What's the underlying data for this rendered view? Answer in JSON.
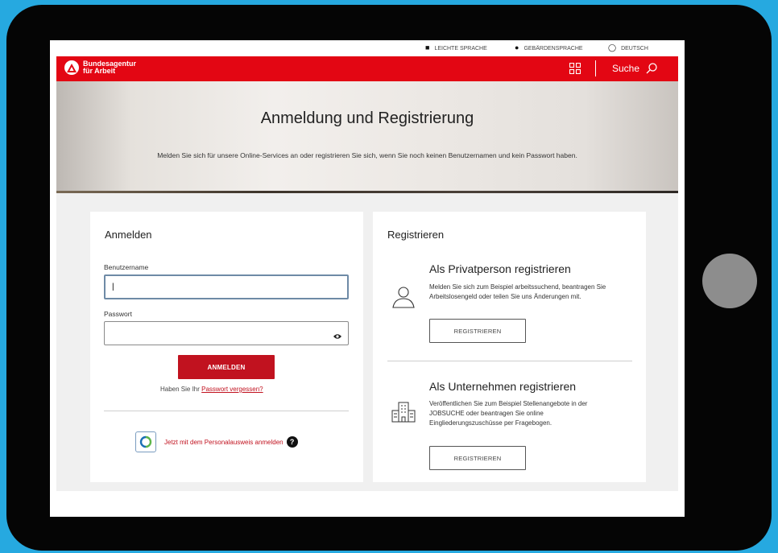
{
  "topbar": {
    "links": [
      {
        "icon": "phone-icon",
        "label": "LEICHTE SPRACHE"
      },
      {
        "icon": "location-icon",
        "label": "GEBÄRDENSPRACHE"
      },
      {
        "icon": "globe-icon",
        "label": "DEUTSCH"
      }
    ]
  },
  "header": {
    "logo_line1": "Bundesagentur",
    "logo_line2": "für Arbeit",
    "search_label": "Suche"
  },
  "hero": {
    "title": "Anmeldung und Registrierung",
    "subtitle": "Melden Sie sich für unsere Online-Services an oder registrieren Sie sich, wenn Sie noch keinen Benutzernamen und kein Passwort haben."
  },
  "login": {
    "title": "Anmelden",
    "username_label": "Benutzername",
    "username_value": "|",
    "password_label": "Passwort",
    "password_value": "",
    "submit_label": "ANMELDEN",
    "forgot_prefix": "Haben Sie Ihr ",
    "forgot_link": "Passwort vergessen?",
    "eid_link": "Jetzt mit dem Personalausweis anmelden",
    "help_glyph": "?"
  },
  "register": {
    "title": "Registrieren",
    "private": {
      "title": "Als Privatperson registrieren",
      "desc": "Melden Sie sich zum Beispiel arbeitssuchend, beantragen Sie Arbeitslosengeld oder teilen Sie uns Änderungen mit.",
      "button": "REGISTRIEREN"
    },
    "company": {
      "title": "Als Unternehmen registrieren",
      "desc": "Veröffentlichen Sie zum Beispiel Stellenangebote in der JOBSUCHE oder beantragen Sie online Eingliederungszuschüsse per Fragebogen.",
      "button": "REGISTRIEREN"
    }
  },
  "colors": {
    "brand_red": "#e30613",
    "button_red": "#c1121f",
    "background_blue": "#26a9e0"
  }
}
